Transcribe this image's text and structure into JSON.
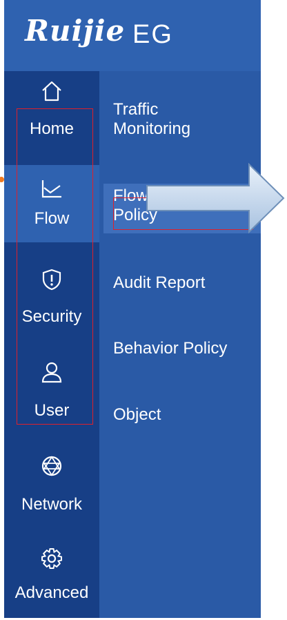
{
  "brand": {
    "logo": "Ruijie",
    "suffix": "EG"
  },
  "sidebar": {
    "items": [
      {
        "label": "Home",
        "icon": "home-icon"
      },
      {
        "label": "Flow",
        "icon": "chart-icon"
      },
      {
        "label": "Security",
        "icon": "shield-icon"
      },
      {
        "label": "User",
        "icon": "user-icon"
      },
      {
        "label": "Network",
        "icon": "network-icon"
      },
      {
        "label": "Advanced",
        "icon": "gear-icon"
      }
    ],
    "active": "Flow"
  },
  "submenu": {
    "items": [
      {
        "label": "Traffic Monitoring"
      },
      {
        "label": "Flow Control Policy"
      },
      {
        "label": "Audit Report"
      },
      {
        "label": "Behavior Policy"
      },
      {
        "label": "Object"
      }
    ],
    "line1": [
      "Traffic",
      "Flow C"
    ],
    "line2": [
      "Monitoring",
      "Policy"
    ]
  },
  "colors": {
    "header": "#2f62b0",
    "sidebar": "#173f86",
    "submenu": "#2a5aa6",
    "active_dot": "#f07a20",
    "highlight_box": "#e0202a",
    "arrow_fill": "#c9dbf0"
  }
}
